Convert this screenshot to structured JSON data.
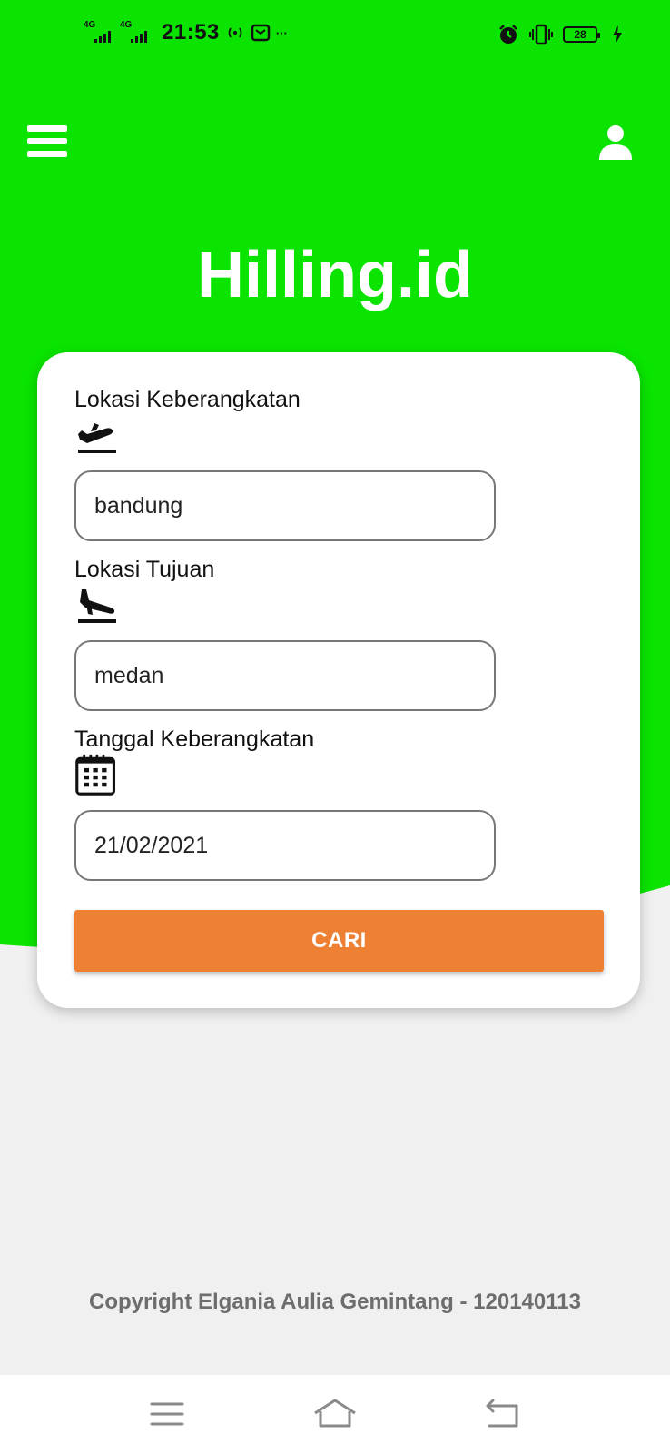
{
  "status_bar": {
    "network_1": "4G",
    "network_2": "4G",
    "time": "21:53",
    "more": "···",
    "battery": "28",
    "icons": [
      "signal-icon",
      "hotspot-icon",
      "message-icon",
      "alarm-icon",
      "vibrate-icon",
      "battery-icon",
      "charging-icon"
    ]
  },
  "header": {
    "title": "Hilling.id",
    "menu_icon": "hamburger-menu-icon",
    "profile_icon": "user-profile-icon"
  },
  "form": {
    "departure": {
      "label": "Lokasi Keberangkatan",
      "icon": "flight-takeoff-icon",
      "value": "bandung"
    },
    "destination": {
      "label": "Lokasi Tujuan",
      "icon": "flight-landing-icon",
      "value": "medan"
    },
    "date": {
      "label": "Tanggal Keberangkatan",
      "icon": "calendar-icon",
      "value": "21/02/2021"
    },
    "search_button": "CARI"
  },
  "footer": {
    "copyright": "Copyright Elgania Aulia Gemintang - 120140113"
  },
  "nav_bar": {
    "icons": [
      "recent-apps-icon",
      "home-icon",
      "back-icon"
    ]
  },
  "colors": {
    "header_green": "#0ae400",
    "button_orange": "#ee8033",
    "background": "#f0f0f0",
    "card": "#ffffff"
  }
}
